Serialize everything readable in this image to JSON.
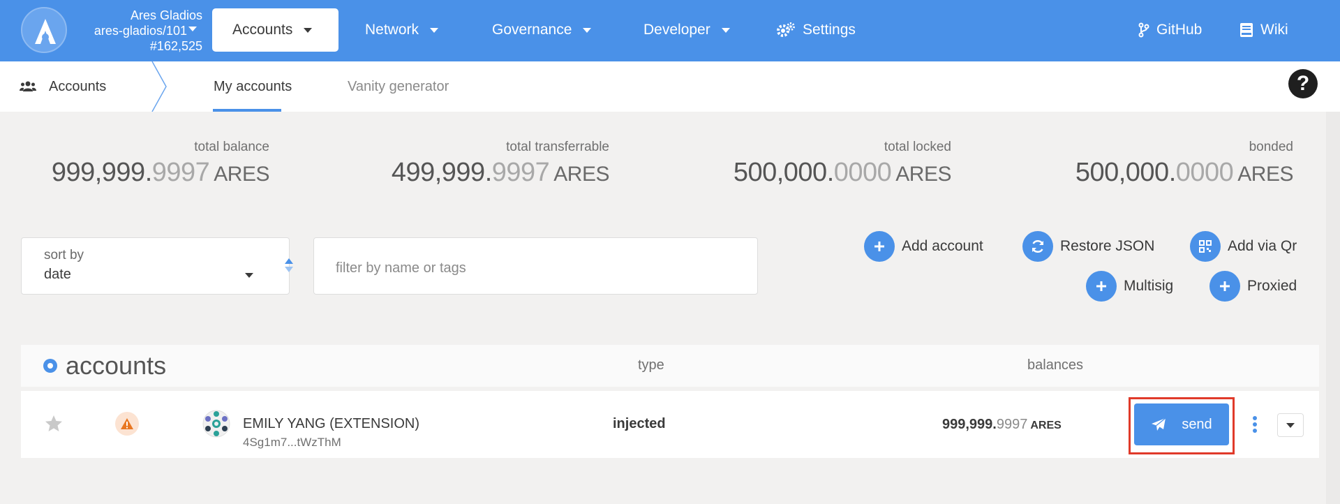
{
  "chain": {
    "name": "Ares Gladios",
    "runtime": "ares-gladios/101",
    "block": "#162,525"
  },
  "nav": {
    "active": "Accounts",
    "items": [
      "Network",
      "Governance",
      "Developer"
    ],
    "settings": "Settings",
    "github": "GitHub",
    "wiki": "Wiki"
  },
  "subnav": {
    "section": "Accounts",
    "tabs": [
      "My accounts",
      "Vanity generator"
    ]
  },
  "summary": [
    {
      "label": "total balance",
      "int": "999,999.",
      "dec": "9997",
      "unit": "ARES"
    },
    {
      "label": "total transferrable",
      "int": "499,999.",
      "dec": "9997",
      "unit": "ARES"
    },
    {
      "label": "total locked",
      "int": "500,000.",
      "dec": "0000",
      "unit": "ARES"
    },
    {
      "label": "bonded",
      "int": "500,000.",
      "dec": "0000",
      "unit": "ARES"
    }
  ],
  "sort": {
    "label": "sort by",
    "value": "date"
  },
  "filter": {
    "placeholder": "filter by name or tags",
    "value": ""
  },
  "actions": {
    "add_account": "Add account",
    "restore_json": "Restore JSON",
    "add_via_qr": "Add via Qr",
    "multisig": "Multisig",
    "proxied": "Proxied"
  },
  "table": {
    "title": "accounts",
    "col_type": "type",
    "col_balances": "balances",
    "rows": [
      {
        "name": "EMILY YANG (EXTENSION)",
        "address": "4Sg1m7...tWzThM",
        "type": "injected",
        "bal_int": "999,999.",
        "bal_dec": "9997",
        "bal_unit": "ARES",
        "send_label": "send"
      }
    ]
  },
  "colors": {
    "accent": "#4a91e8",
    "highlight": "#e03a2a",
    "warning": "#e87722"
  }
}
